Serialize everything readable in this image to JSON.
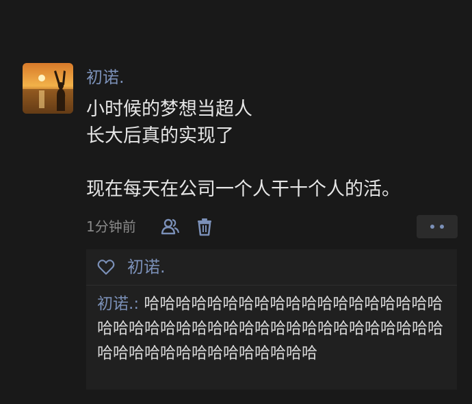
{
  "post": {
    "author": "初诺.",
    "content_lines": [
      "小时候的梦想当超人",
      "长大后真的实现了",
      "",
      "现在每天在公司一个人干十个人的活。"
    ],
    "time": "1分钟前"
  },
  "interaction": {
    "likes": [
      "初诺."
    ],
    "comments": [
      {
        "author": "初诺.",
        "separator": ": ",
        "text": "哈哈哈哈哈哈哈哈哈哈哈哈哈哈哈哈哈哈哈哈哈哈哈哈哈哈哈哈哈哈哈哈哈哈哈哈哈哈哈哈哈哈哈哈哈哈哈哈哈哈哈哈哈哈哈"
      }
    ]
  },
  "icons": {
    "avatar": "sunset-photo",
    "visibility": "friends-icon",
    "delete": "trash-icon",
    "more": "more-dots-icon",
    "like": "heart-outline-icon"
  },
  "colors": {
    "background": "#191919",
    "link": "#7b90b8",
    "text": "#e6e6e6",
    "muted": "#8a8a8a",
    "panel": "#202020"
  }
}
